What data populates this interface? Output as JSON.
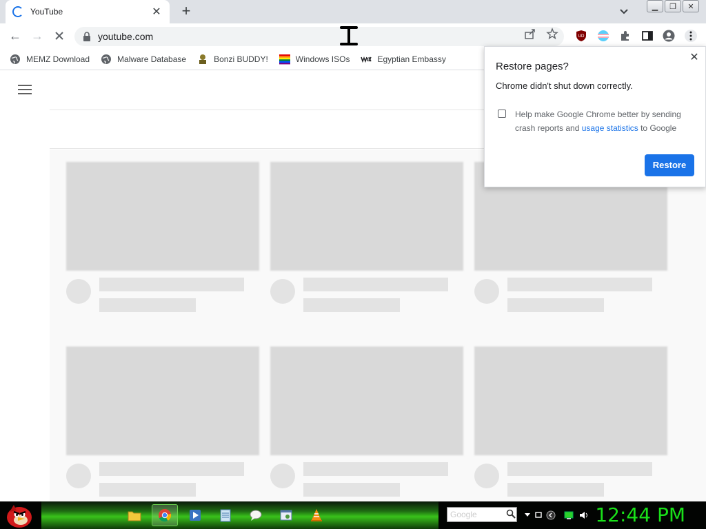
{
  "browser": {
    "tab": {
      "title": "YouTube"
    },
    "address": {
      "url": "youtube.com"
    }
  },
  "bookmarks": [
    {
      "label": "MEMZ Download",
      "icon": "globe-icon"
    },
    {
      "label": "Malware Database",
      "icon": "globe-icon"
    },
    {
      "label": "Bonzi BUDDY!",
      "icon": "bonzi-icon"
    },
    {
      "label": "Windows ISOs",
      "icon": "rainbow-flag-icon"
    },
    {
      "label": "Egyptian Embassy",
      "icon": "wix-icon"
    }
  ],
  "dialog": {
    "title": "Restore pages?",
    "message": "Chrome didn't shut down correctly.",
    "help_text_before": "Help make Google Chrome better by sending crash reports and ",
    "help_link": "usage statistics",
    "help_text_after": " to Google",
    "restore_label": "Restore"
  },
  "taskbar": {
    "search_placeholder": "Google",
    "clock": "12:44 PM"
  },
  "colors": {
    "accent": "#1a73e8",
    "clock": "#19e019",
    "taskbar_green": "#39c21b"
  }
}
